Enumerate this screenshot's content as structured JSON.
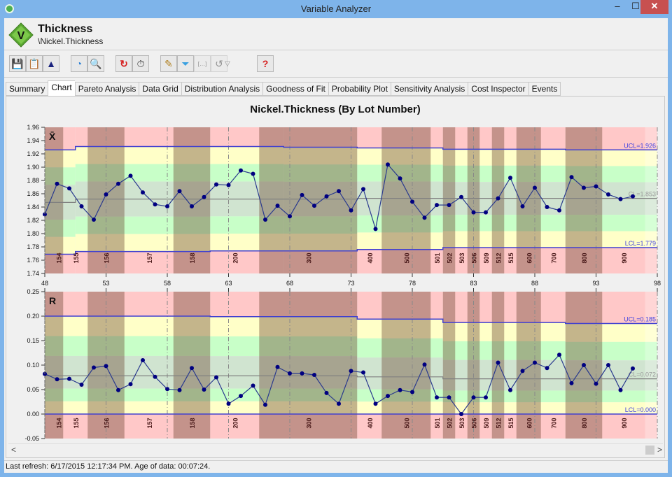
{
  "window": {
    "title": "Variable Analyzer",
    "min_label": "–",
    "max_label": "☐",
    "close_label": "✕"
  },
  "header": {
    "title": "Thickness",
    "path": "\\Nickel.Thickness",
    "logo_letter": "V"
  },
  "toolbar": [
    {
      "name": "save-icon",
      "glyph": "💾",
      "disabled": false
    },
    {
      "name": "copy-icon",
      "glyph": "📋",
      "disabled": false
    },
    {
      "name": "chart-image-icon",
      "glyph": "▲",
      "disabled": false
    },
    {
      "name": "gauge-icon",
      "glyph": "◔",
      "disabled": false
    },
    {
      "name": "zoom-preview-icon",
      "glyph": "🔍",
      "disabled": false
    },
    {
      "name": "refresh-icon",
      "glyph": "↻",
      "disabled": false
    },
    {
      "name": "timer-icon",
      "glyph": "⏱",
      "disabled": false
    },
    {
      "name": "edit-icon",
      "glyph": "✎",
      "disabled": false
    },
    {
      "name": "filter-icon",
      "glyph": "⏷",
      "disabled": false
    },
    {
      "name": "ellipsis-icon",
      "glyph": "[…]",
      "disabled": true
    },
    {
      "name": "undo-icon",
      "glyph": "↺",
      "disabled": true
    },
    {
      "name": "dropdown-icon",
      "glyph": "▽",
      "disabled": true
    },
    {
      "name": "help-icon",
      "glyph": "?",
      "disabled": false
    }
  ],
  "tabs": [
    {
      "label": "Summary",
      "active": false
    },
    {
      "label": "Chart",
      "active": true
    },
    {
      "label": "Pareto Analysis",
      "active": false
    },
    {
      "label": "Data Grid",
      "active": false
    },
    {
      "label": "Distribution Analysis",
      "active": false
    },
    {
      "label": "Goodness of Fit",
      "active": false
    },
    {
      "label": "Probability Plot",
      "active": false
    },
    {
      "label": "Sensitivity Analysis",
      "active": false
    },
    {
      "label": "Cost Inspector",
      "active": false
    },
    {
      "label": "Events",
      "active": false
    }
  ],
  "status": {
    "text": "Last refresh: 6/17/2015 12:17:34 PM.  Age of data: 00:07:24."
  },
  "scrollbar": {
    "left_arrow": "<",
    "right_arrow": ">"
  },
  "colors": {
    "line": "#1a237e",
    "point": "#000080",
    "limit": "#4040d0",
    "center": "#808080",
    "red": "#ffc8c8",
    "yellow": "#ffffc8",
    "green": "#c8ffc8",
    "center_zone": "#d0e4d0",
    "dark": "rgba(100,60,40,0.38)"
  },
  "chart_data": {
    "type": "line",
    "title": "Nickel.Thickness (By Lot Number)",
    "x": [
      48,
      49,
      50,
      51,
      52,
      53,
      54,
      55,
      56,
      57,
      58,
      59,
      60,
      61,
      62,
      63,
      64,
      65,
      66,
      67,
      68,
      69,
      70,
      71,
      72,
      73,
      74,
      75,
      76,
      77,
      78,
      79,
      80,
      81,
      82,
      83,
      84,
      85,
      86,
      87,
      88,
      89,
      90,
      91,
      92,
      93,
      94,
      95,
      96
    ],
    "xlim": [
      48,
      98
    ],
    "xticks": [
      48,
      53,
      58,
      63,
      68,
      73,
      78,
      83,
      88,
      93,
      98
    ],
    "lots": [
      {
        "label": "154",
        "from": 48,
        "to": 49.5,
        "dark": true
      },
      {
        "label": "155",
        "from": 49.5,
        "to": 51.5,
        "dark": false
      },
      {
        "label": "156",
        "from": 51.5,
        "to": 54.5,
        "dark": true
      },
      {
        "label": "157",
        "from": 54.5,
        "to": 58.5,
        "dark": false
      },
      {
        "label": "158",
        "from": 58.5,
        "to": 61.5,
        "dark": true
      },
      {
        "label": "200",
        "from": 61.5,
        "to": 65.5,
        "dark": false
      },
      {
        "label": "300",
        "from": 65.5,
        "to": 73.5,
        "dark": true
      },
      {
        "label": "400",
        "from": 73.5,
        "to": 75.5,
        "dark": false
      },
      {
        "label": "500",
        "from": 75.5,
        "to": 79.5,
        "dark": true
      },
      {
        "label": "501",
        "from": 79.5,
        "to": 80.5,
        "dark": false
      },
      {
        "label": "502",
        "from": 80.5,
        "to": 81.5,
        "dark": true
      },
      {
        "label": "503",
        "from": 81.5,
        "to": 82.5,
        "dark": false
      },
      {
        "label": "506",
        "from": 82.5,
        "to": 83.5,
        "dark": true
      },
      {
        "label": "509",
        "from": 83.5,
        "to": 84.5,
        "dark": false
      },
      {
        "label": "512",
        "from": 84.5,
        "to": 85.5,
        "dark": true
      },
      {
        "label": "515",
        "from": 85.5,
        "to": 86.5,
        "dark": false
      },
      {
        "label": "600",
        "from": 86.5,
        "to": 88.5,
        "dark": true
      },
      {
        "label": "700",
        "from": 88.5,
        "to": 90.5,
        "dark": false
      },
      {
        "label": "800",
        "from": 90.5,
        "to": 93.5,
        "dark": true
      },
      {
        "label": "900",
        "from": 93.5,
        "to": 97,
        "dark": false
      }
    ],
    "panels": [
      {
        "name": "xbar",
        "label": "X̄",
        "ylim": [
          1.74,
          1.96
        ],
        "yticks": [
          1.74,
          1.76,
          1.78,
          1.8,
          1.82,
          1.84,
          1.86,
          1.88,
          1.9,
          1.92,
          1.94,
          1.96
        ],
        "ytick_decimals": 2,
        "values": [
          1.829,
          1.875,
          1.868,
          1.841,
          1.821,
          1.859,
          1.875,
          1.887,
          1.862,
          1.844,
          1.841,
          1.864,
          1.841,
          1.855,
          1.874,
          1.873,
          1.895,
          1.89,
          1.821,
          1.842,
          1.826,
          1.858,
          1.842,
          1.856,
          1.864,
          1.835,
          1.867,
          1.807,
          1.904,
          1.883,
          1.848,
          1.824,
          1.843,
          1.843,
          1.855,
          1.832,
          1.832,
          1.853,
          1.884,
          1.841,
          1.869,
          1.84,
          1.835,
          1.885,
          1.869,
          1.871,
          1.859,
          1.852,
          1.856
        ],
        "ucl_steps": [
          [
            48,
            1.926
          ],
          [
            50.5,
            1.931
          ],
          [
            67.5,
            1.93
          ],
          [
            73.5,
            1.929
          ],
          [
            80.5,
            1.927
          ],
          [
            90.5,
            1.926
          ]
        ],
        "lcl_steps": [
          [
            48,
            1.769
          ],
          [
            50.5,
            1.773
          ],
          [
            61.5,
            1.774
          ],
          [
            73.5,
            1.776
          ],
          [
            80.5,
            1.779
          ]
        ],
        "cl_steps": [
          [
            48,
            1.847
          ],
          [
            50.5,
            1.852
          ],
          [
            73.5,
            1.853
          ]
        ],
        "ucl_label": "UCL=1.926",
        "cl_label": "CL=1.853",
        "lcl_label": "LCL=1.779"
      },
      {
        "name": "range",
        "label": "R",
        "ylim": [
          -0.05,
          0.25
        ],
        "yticks": [
          -0.05,
          0.0,
          0.05,
          0.1,
          0.15,
          0.2,
          0.25
        ],
        "ytick_decimals": 2,
        "values": [
          0.082,
          0.071,
          0.072,
          0.06,
          0.095,
          0.098,
          0.049,
          0.061,
          0.11,
          0.076,
          0.051,
          0.049,
          0.094,
          0.05,
          0.075,
          0.021,
          0.037,
          0.058,
          0.019,
          0.096,
          0.083,
          0.083,
          0.08,
          0.043,
          0.021,
          0.088,
          0.085,
          0.021,
          0.037,
          0.049,
          0.045,
          0.101,
          0.034,
          0.034,
          0.0,
          0.034,
          0.034,
          0.105,
          0.049,
          0.088,
          0.105,
          0.094,
          0.121,
          0.063,
          0.1,
          0.062,
          0.1,
          0.049,
          0.093
        ],
        "ucl_steps": [
          [
            48,
            0.2
          ],
          [
            61.5,
            0.199
          ],
          [
            73.5,
            0.194
          ],
          [
            80.5,
            0.187
          ],
          [
            90.5,
            0.185
          ]
        ],
        "lcl_steps": [
          [
            48,
            0.0
          ]
        ],
        "cl_steps": [
          [
            48,
            0.078
          ],
          [
            73.5,
            0.076
          ],
          [
            80.5,
            0.072
          ]
        ],
        "ucl_label": "UCL=0.185",
        "cl_label": "CL=0.072",
        "lcl_label": "LCL=0.000"
      }
    ]
  }
}
